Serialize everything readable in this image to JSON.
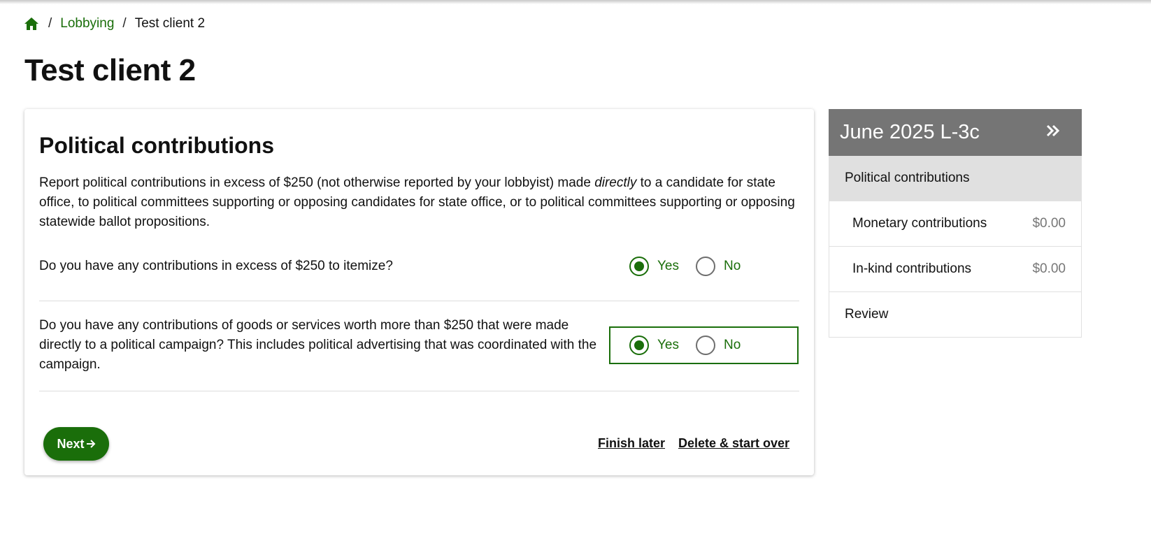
{
  "breadcrumb": {
    "home_icon": "home-icon",
    "items": [
      "Lobbying",
      "Test client 2"
    ]
  },
  "page_title": "Test client 2",
  "card": {
    "heading": "Political contributions",
    "intro_before": "Report political contributions in excess of $250 (not otherwise reported by your lobbyist) made ",
    "intro_emph": "directly",
    "intro_after": " to a candidate for state office, to political committees supporting or opposing candidates for state office, or to political committees supporting or opposing statewide ballot propositions.",
    "questions": [
      {
        "text": "Do you have any contributions in excess of $250 to itemize?",
        "options": [
          "Yes",
          "No"
        ],
        "selected": "Yes"
      },
      {
        "text": "Do you have any contributions of goods or services worth more than $250 that were made directly to a political campaign? This includes political advertising that was coordinated with the campaign.",
        "options": [
          "Yes",
          "No"
        ],
        "selected": "Yes"
      }
    ],
    "next_label": "Next",
    "finish_later_label": "Finish later",
    "delete_label": "Delete & start over"
  },
  "sidebar": {
    "title": "June 2025 L-3c",
    "collapse_icon": "double-chevron-right-icon",
    "items": [
      {
        "label": "Political contributions",
        "amount": ""
      },
      {
        "label": "Monetary contributions",
        "amount": "$0.00"
      },
      {
        "label": "In-kind contributions",
        "amount": "$0.00"
      },
      {
        "label": "Review",
        "amount": ""
      }
    ]
  },
  "colors": {
    "accent": "#1a6e0a",
    "sidebar_header": "#757575",
    "active_item": "#e0e0e0"
  }
}
